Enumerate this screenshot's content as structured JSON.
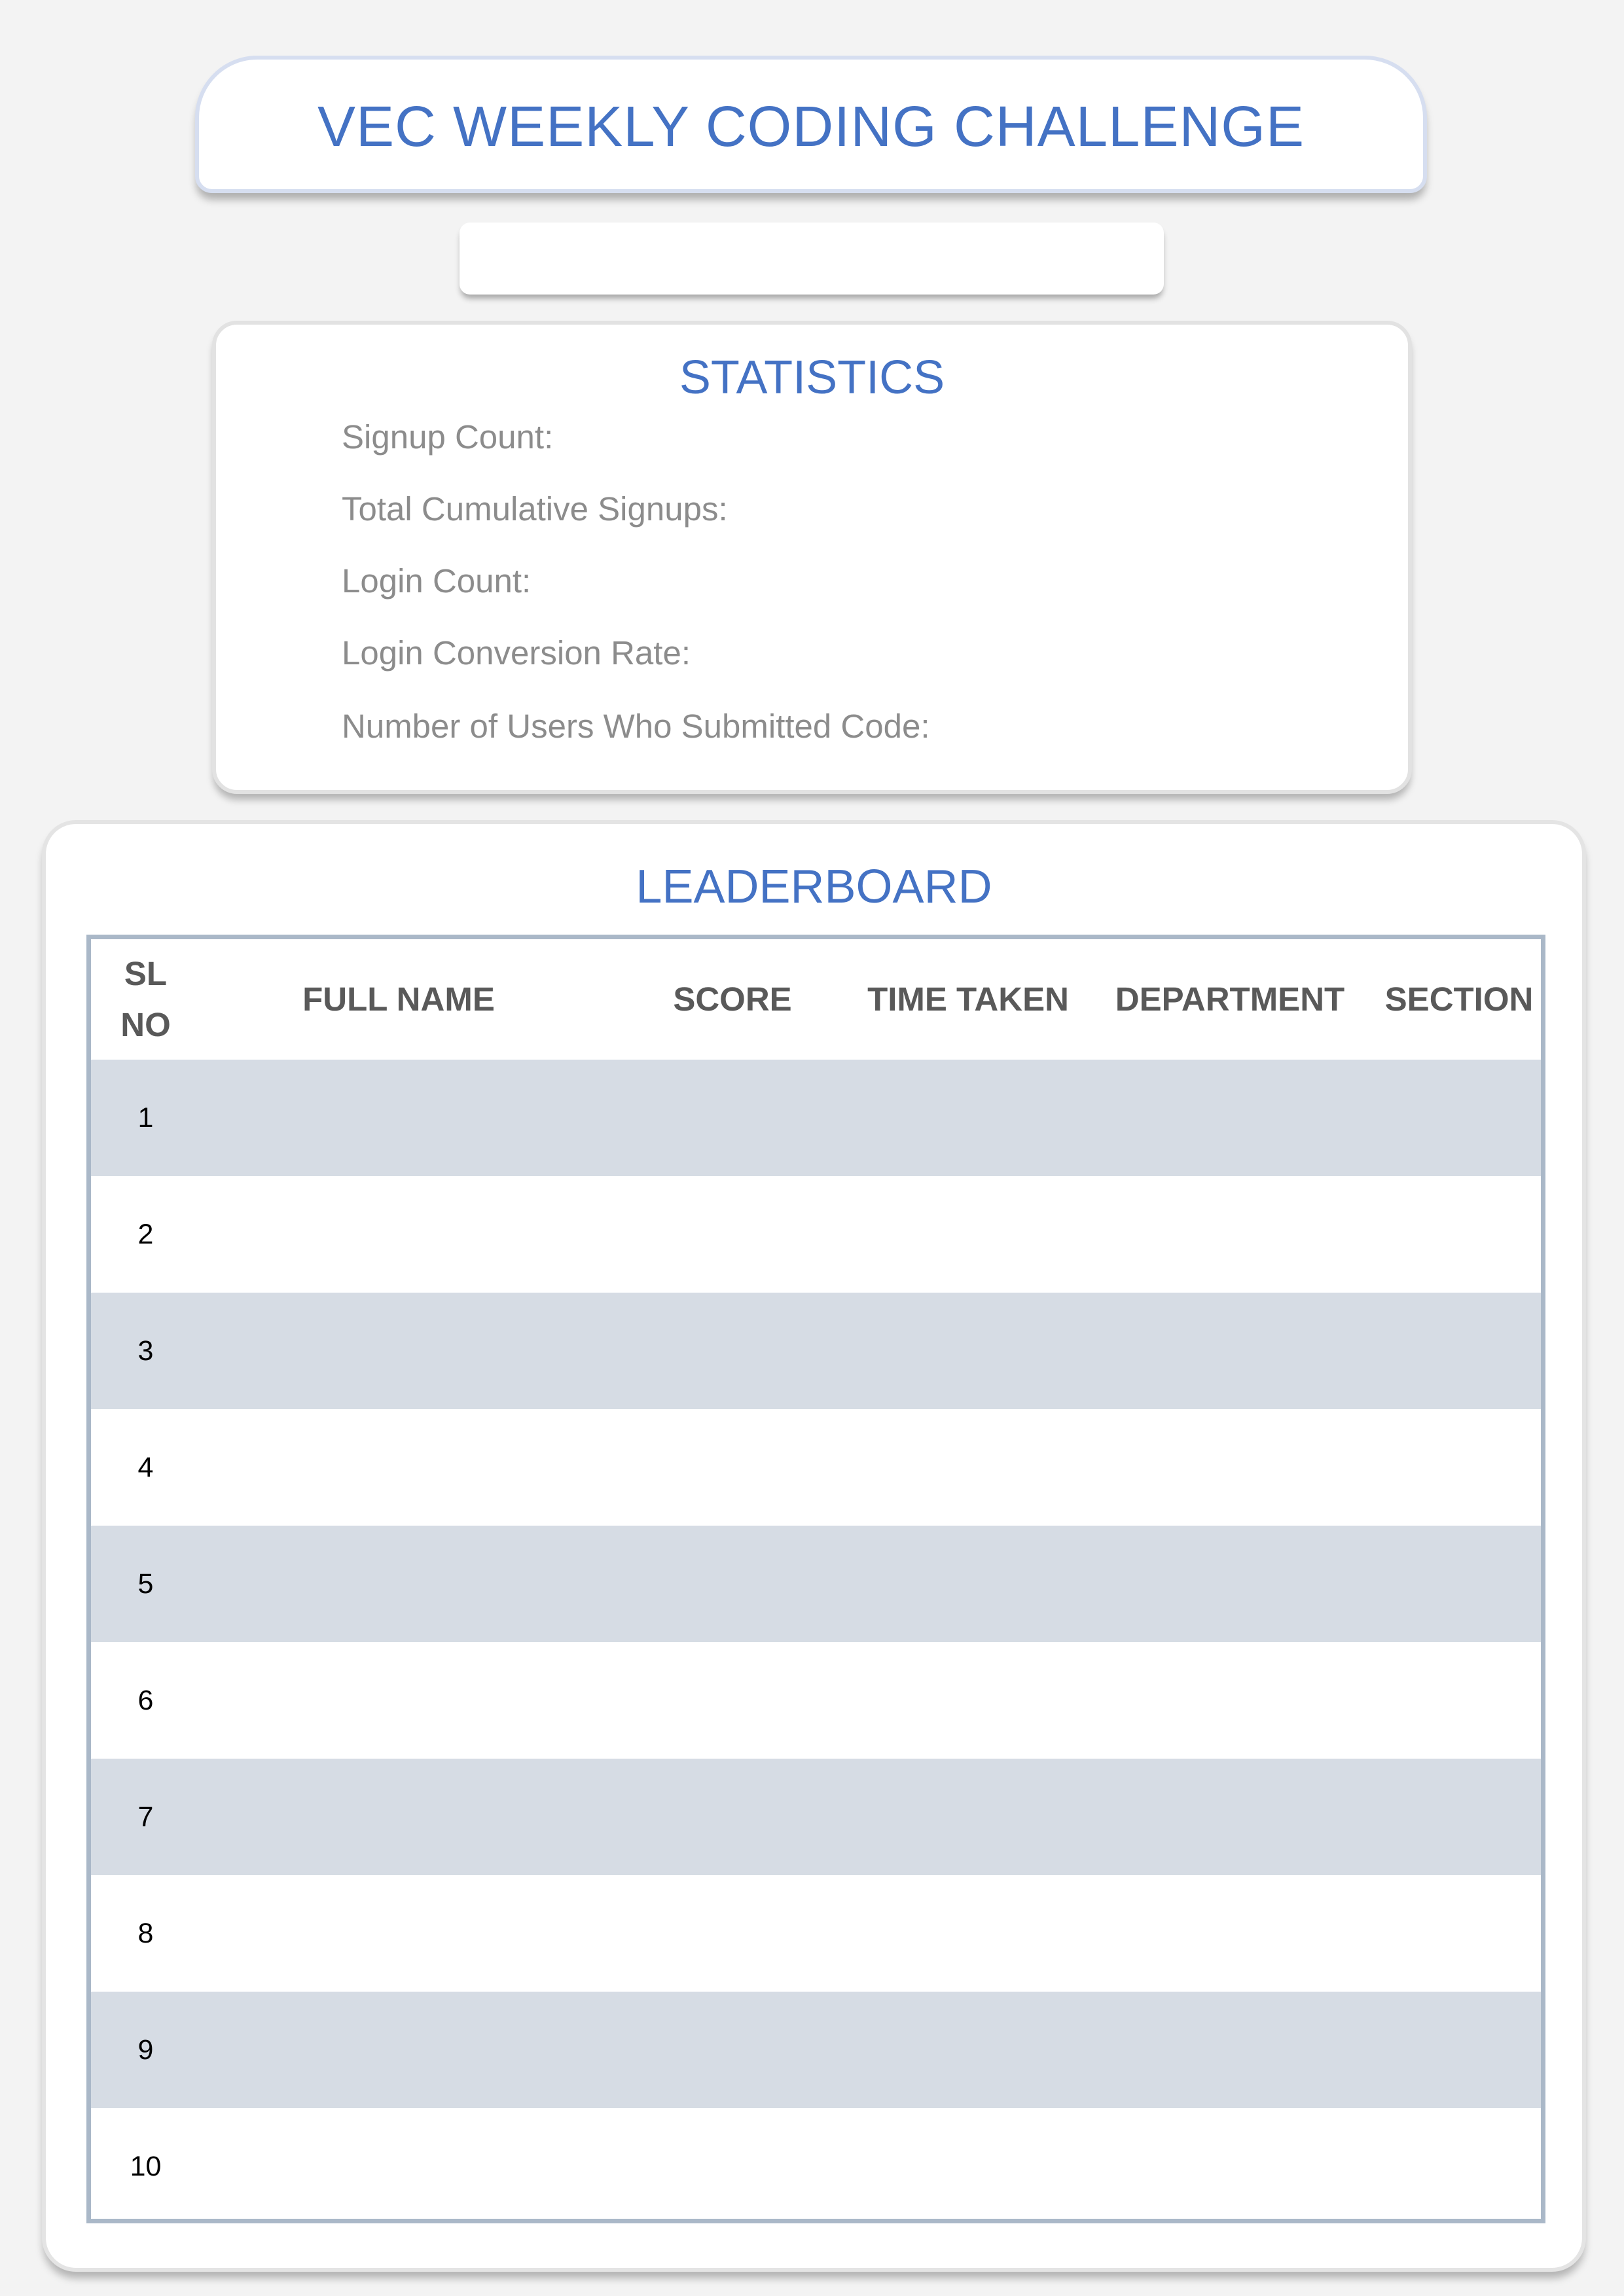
{
  "header": {
    "title": "VEC WEEKLY CODING CHALLENGE",
    "subtitle": ""
  },
  "statistics": {
    "heading": "STATISTICS",
    "items": [
      "Signup Count:",
      "Total Cumulative Signups:",
      "Login Count:",
      "Login Conversion Rate:",
      "Number of Users Who Submitted Code:"
    ]
  },
  "leaderboard": {
    "heading": "LEADERBOARD",
    "columns": {
      "sl_no_line1": "SL",
      "sl_no_line2": "NO",
      "full_name": "FULL NAME",
      "score": "SCORE",
      "time_taken": "TIME TAKEN",
      "department": "DEPARTMENT",
      "section": "SECTION"
    },
    "rows": [
      {
        "sl_no": "1"
      },
      {
        "sl_no": "2"
      },
      {
        "sl_no": "3"
      },
      {
        "sl_no": "4"
      },
      {
        "sl_no": "5"
      },
      {
        "sl_no": "6"
      },
      {
        "sl_no": "7"
      },
      {
        "sl_no": "8"
      },
      {
        "sl_no": "9"
      },
      {
        "sl_no": "10"
      }
    ]
  },
  "colors": {
    "accent": "#4472c4",
    "row_shade": "#d6dce4",
    "table_border": "#aab8c8",
    "stat_text": "#8c8c8c",
    "header_text": "#595959",
    "page_background": "#f3f3f3"
  }
}
